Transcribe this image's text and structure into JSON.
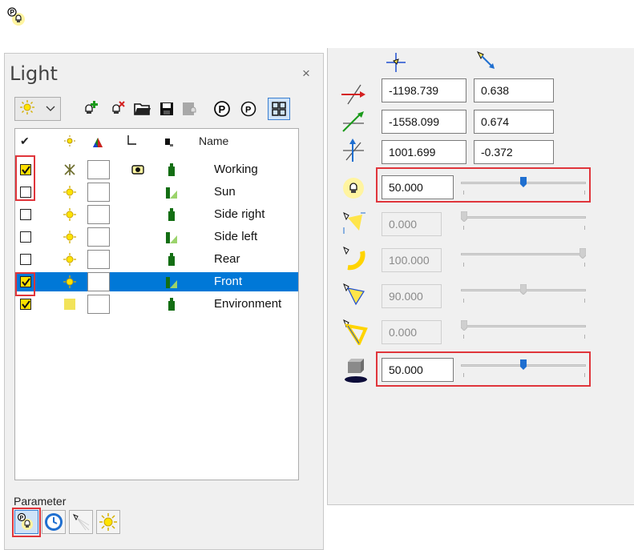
{
  "panel": {
    "title": "Light",
    "close": "×",
    "columns": {
      "check": "✔",
      "name": "Name"
    },
    "rows": [
      {
        "name": "Working",
        "checked": true,
        "selected": false
      },
      {
        "name": "Sun",
        "checked": false,
        "selected": false
      },
      {
        "name": "Side right",
        "checked": false,
        "selected": false
      },
      {
        "name": "Side left",
        "checked": false,
        "selected": false
      },
      {
        "name": "Rear",
        "checked": false,
        "selected": false
      },
      {
        "name": "Front",
        "checked": true,
        "selected": true
      },
      {
        "name": "Environment",
        "checked": true,
        "selected": false
      }
    ],
    "parameter_label": "Parameter"
  },
  "position": {
    "x": {
      "a": "-1198.739",
      "b": "0.638"
    },
    "y": {
      "a": "-1558.099",
      "b": "0.674"
    },
    "z": {
      "a": "1001.699",
      "b": "-0.372"
    }
  },
  "params": {
    "intensity": {
      "value": "50.000",
      "level": 0.5
    },
    "param2": {
      "value": "0.000",
      "level": 0.0
    },
    "param3": {
      "value": "100.000",
      "level": 1.0
    },
    "param4": {
      "value": "90.000",
      "level": 0.5
    },
    "param5": {
      "value": "0.000",
      "level": 0.0
    },
    "shadow": {
      "value": "50.000",
      "level": 0.5
    }
  },
  "colors": {
    "highlight": "#e0353b",
    "selection": "#0078d7",
    "slider_thumb": "#1f6fd0"
  }
}
